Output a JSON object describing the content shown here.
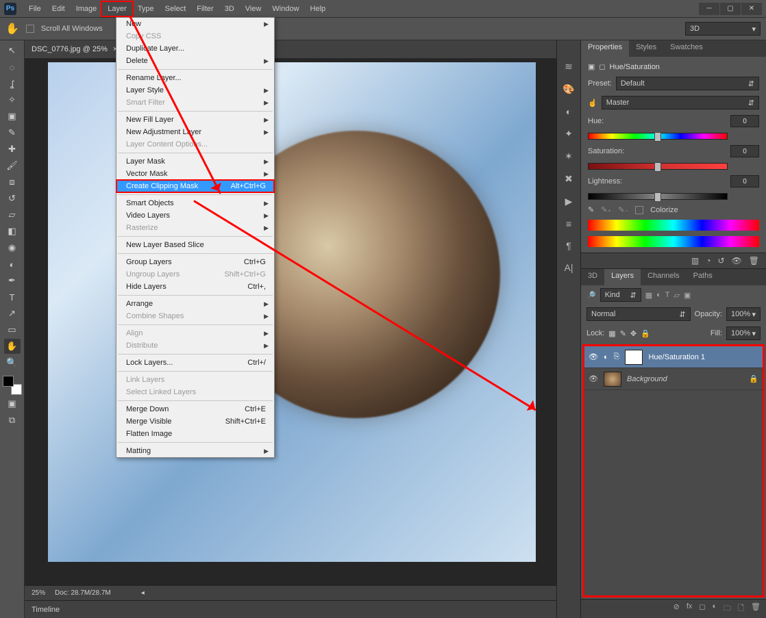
{
  "app": {
    "logo_text": "Ps"
  },
  "menubar": [
    "File",
    "Edit",
    "Image",
    "Layer",
    "Type",
    "Select",
    "Filter",
    "3D",
    "View",
    "Window",
    "Help"
  ],
  "menubar_highlight": "Layer",
  "options": {
    "scroll_all": "Scroll All Windows",
    "dd3d": "3D"
  },
  "document": {
    "tab": "DSC_0776.jpg @ 25%",
    "close": "×",
    "zoom": "25%",
    "docinfo": "Doc: 28.7M/28.7M",
    "timeline": "Timeline"
  },
  "layer_menu": [
    {
      "t": "item",
      "label": "New",
      "sub": true
    },
    {
      "t": "item",
      "label": "Copy CSS",
      "dis": true
    },
    {
      "t": "item",
      "label": "Duplicate Layer..."
    },
    {
      "t": "item",
      "label": "Delete",
      "sub": true
    },
    {
      "t": "sep"
    },
    {
      "t": "item",
      "label": "Rename Layer..."
    },
    {
      "t": "item",
      "label": "Layer Style",
      "sub": true
    },
    {
      "t": "item",
      "label": "Smart Filter",
      "dis": true,
      "sub": true
    },
    {
      "t": "sep"
    },
    {
      "t": "item",
      "label": "New Fill Layer",
      "sub": true
    },
    {
      "t": "item",
      "label": "New Adjustment Layer",
      "sub": true
    },
    {
      "t": "item",
      "label": "Layer Content Options...",
      "dis": true
    },
    {
      "t": "sep"
    },
    {
      "t": "item",
      "label": "Layer Mask",
      "sub": true
    },
    {
      "t": "item",
      "label": "Vector Mask",
      "sub": true
    },
    {
      "t": "item",
      "label": "Create Clipping Mask",
      "sc": "Alt+Ctrl+G",
      "sel": true
    },
    {
      "t": "sep"
    },
    {
      "t": "item",
      "label": "Smart Objects",
      "sub": true
    },
    {
      "t": "item",
      "label": "Video Layers",
      "sub": true
    },
    {
      "t": "item",
      "label": "Rasterize",
      "dis": true,
      "sub": true
    },
    {
      "t": "sep"
    },
    {
      "t": "item",
      "label": "New Layer Based Slice"
    },
    {
      "t": "sep"
    },
    {
      "t": "item",
      "label": "Group Layers",
      "sc": "Ctrl+G"
    },
    {
      "t": "item",
      "label": "Ungroup Layers",
      "sc": "Shift+Ctrl+G",
      "dis": true
    },
    {
      "t": "item",
      "label": "Hide Layers",
      "sc": "Ctrl+,"
    },
    {
      "t": "sep"
    },
    {
      "t": "item",
      "label": "Arrange",
      "sub": true
    },
    {
      "t": "item",
      "label": "Combine Shapes",
      "dis": true,
      "sub": true
    },
    {
      "t": "sep"
    },
    {
      "t": "item",
      "label": "Align",
      "dis": true,
      "sub": true
    },
    {
      "t": "item",
      "label": "Distribute",
      "dis": true,
      "sub": true
    },
    {
      "t": "sep"
    },
    {
      "t": "item",
      "label": "Lock Layers...",
      "sc": "Ctrl+/"
    },
    {
      "t": "sep"
    },
    {
      "t": "item",
      "label": "Link Layers",
      "dis": true
    },
    {
      "t": "item",
      "label": "Select Linked Layers",
      "dis": true
    },
    {
      "t": "sep"
    },
    {
      "t": "item",
      "label": "Merge Down",
      "sc": "Ctrl+E"
    },
    {
      "t": "item",
      "label": "Merge Visible",
      "sc": "Shift+Ctrl+E"
    },
    {
      "t": "item",
      "label": "Flatten Image"
    },
    {
      "t": "sep"
    },
    {
      "t": "item",
      "label": "Matting",
      "sub": true
    }
  ],
  "properties": {
    "tabs": [
      "Properties",
      "Styles",
      "Swatches"
    ],
    "title": "Hue/Saturation",
    "preset_label": "Preset:",
    "preset_value": "Default",
    "channel": "Master",
    "hue_label": "Hue:",
    "hue_value": "0",
    "sat_label": "Saturation:",
    "sat_value": "0",
    "light_label": "Lightness:",
    "light_value": "0",
    "colorize": "Colorize"
  },
  "layers": {
    "tabs": [
      "3D",
      "Layers",
      "Channels",
      "Paths"
    ],
    "kind": "Kind",
    "blend": "Normal",
    "opacity_label": "Opacity:",
    "opacity": "100%",
    "lock_label": "Lock:",
    "fill_label": "Fill:",
    "fill": "100%",
    "items": [
      {
        "name": "Hue/Saturation 1",
        "sel": true,
        "adj": true
      },
      {
        "name": "Background",
        "sel": false,
        "locked": true,
        "italic": true
      }
    ],
    "fx": "fx"
  }
}
